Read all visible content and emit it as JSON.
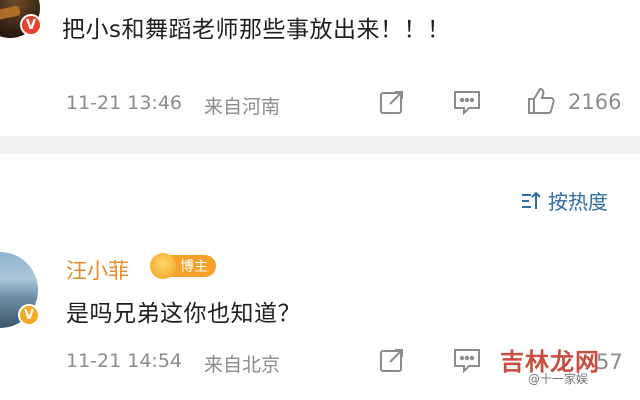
{
  "comment1": {
    "text": "把小s和舞蹈老师那些事放出来！！！",
    "time": "11-21 13:46",
    "location": "来自河南",
    "like_count": "2166",
    "icons": [
      "share-icon",
      "comment-icon",
      "like-icon"
    ]
  },
  "sort": {
    "label": "按热度",
    "icon": "sort-icon"
  },
  "comment2": {
    "username": "汪小菲",
    "badge": "博主",
    "text": "是吗兄弟这你也知道？",
    "time": "11-21 14:54",
    "location": "来自北京",
    "like_count": "57",
    "icons": [
      "share-icon",
      "comment-icon",
      "like-icon"
    ]
  },
  "watermark": {
    "main": "吉林龙网",
    "sub": "@十一家娱"
  },
  "colors": {
    "username": "#e8892a",
    "sort_link": "#2f6da8",
    "meta_gray": "#8c8c8c",
    "divider": "#f2f2f2",
    "verified_orange": "#f5a623",
    "verified_red": "#e8412e"
  }
}
